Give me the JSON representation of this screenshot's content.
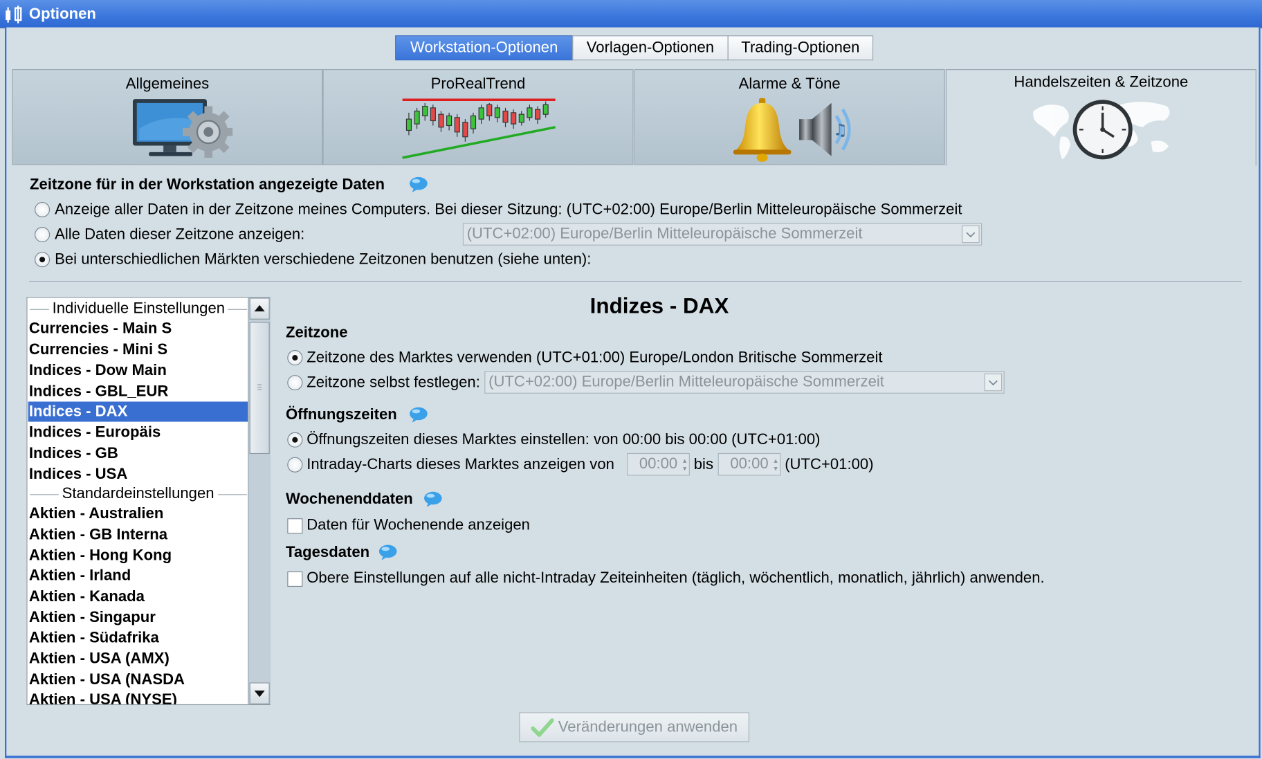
{
  "window": {
    "title": "Optionen"
  },
  "top_tabs": [
    {
      "label": "Workstation-Optionen",
      "active": true
    },
    {
      "label": "Vorlagen-Optionen",
      "active": false
    },
    {
      "label": "Trading-Optionen",
      "active": false
    }
  ],
  "icon_tabs": [
    {
      "label": "Allgemeines",
      "icon": "monitor-gear-icon",
      "active": false
    },
    {
      "label": "ProRealTrend",
      "icon": "trend-chart-icon",
      "active": false
    },
    {
      "label": "Alarme & Töne",
      "icon": "bell-speaker-icon",
      "active": false
    },
    {
      "label": "Handelszeiten & Zeitzone",
      "icon": "world-clock-icon",
      "active": true
    }
  ],
  "timezone_section": {
    "heading": "Zeitzone für in der Workstation angezeigte Daten",
    "options": [
      {
        "label": "Anzeige aller Daten in der Zeitzone meines Computers. Bei dieser Sitzung: (UTC+02:00) Europe/Berlin Mitteleuropäische Sommerzeit",
        "selected": false
      },
      {
        "label": "Alle Daten dieser Zeitzone anzeigen:",
        "selected": false
      },
      {
        "label": "Bei unterschiedlichen Märkten verschiedene Zeitzonen benutzen (siehe unten):",
        "selected": true
      }
    ],
    "zone_select_value": "(UTC+02:00) Europe/Berlin Mitteleuropäische Sommerzeit"
  },
  "market_list": {
    "group_individual": "Individuelle Einstellungen",
    "individual": [
      "Currencies - Main S",
      "Currencies - Mini S",
      "Indices - Dow Main",
      "Indices - GBL_EUR",
      "Indices - DAX",
      "Indices - Europäis",
      "Indices - GB",
      "Indices - USA"
    ],
    "selected": "Indices - DAX",
    "group_standard": "Standardeinstellungen",
    "standard": [
      "Aktien - Australien",
      "Aktien - GB Interna",
      "Aktien - Hong Kong",
      "Aktien - Irland",
      "Aktien - Kanada",
      "Aktien - Singapur",
      "Aktien - Südafrika",
      "Aktien - USA (AMX)",
      "Aktien - USA (NASDA",
      "Aktien - USA (NYSE)"
    ]
  },
  "detail": {
    "title": "Indizes - DAX",
    "zeitzone": {
      "heading": "Zeitzone",
      "market_tz_label": "Zeitzone des Marktes verwenden (UTC+01:00) Europe/London Britische Sommerzeit",
      "market_tz_selected": true,
      "own_tz_label": "Zeitzone selbst festlegen:",
      "own_tz_selected": false,
      "own_tz_value": "(UTC+02:00) Europe/Berlin Mitteleuropäische Sommerzeit"
    },
    "oeffnungszeiten": {
      "heading": "Öffnungszeiten",
      "set_label": "Öffnungszeiten dieses Marktes einstellen: von 00:00 bis 00:00 (UTC+01:00)",
      "set_selected": true,
      "intraday_label": "Intraday-Charts dieses Marktes anzeigen von",
      "intraday_selected": false,
      "from_value": "00:00",
      "bis_label": "bis",
      "to_value": "00:00",
      "tz_suffix": "(UTC+01:00)"
    },
    "wochenende": {
      "heading": "Wochenenddaten",
      "checkbox_label": "Daten für Wochenende anzeigen",
      "checked": false
    },
    "tagesdaten": {
      "heading": "Tagesdaten",
      "checkbox_label": "Obere Einstellungen auf alle nicht-Intraday Zeiteinheiten (täglich, wöchentlich, monatlich, jährlich) anwenden.",
      "checked": false
    }
  },
  "apply_button": {
    "label": "Veränderungen anwenden",
    "enabled": false
  },
  "colors": {
    "accent": "#3a6fd2",
    "titlebar": "#3a76dc",
    "background": "#d4dfe5"
  }
}
